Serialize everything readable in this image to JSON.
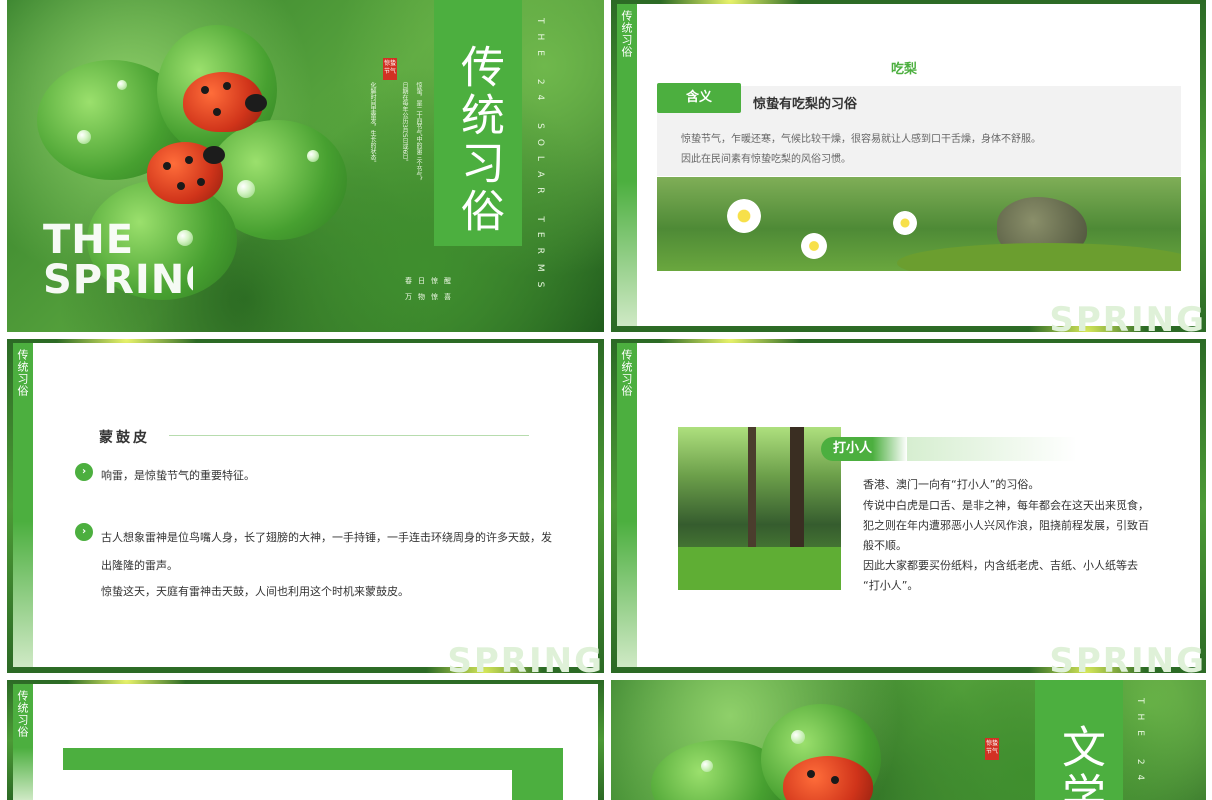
{
  "slides": {
    "title": {
      "section_title": "传统习俗",
      "english_big": [
        "THE",
        "SPRING"
      ],
      "english_vertical": "THE 24 SOLAR TERMS",
      "seal": "惊蛰节气",
      "tagline": [
        "春日惊醒",
        "万物惊喜"
      ],
      "desc_lines": [
        "惊蛰，是二十四节气中的第三个节气，",
        "日期在每年公历3月5日或6日。",
        "化解时间里雷发，生长的状态。"
      ]
    },
    "eat_pear": {
      "side_label": "传统习俗",
      "title": "吃梨",
      "pill": "含义",
      "heading": "惊蛰有吃梨的习俗",
      "lines": [
        "惊蛰节气，乍暖还寒，气候比较干燥，很容易就让人感到口干舌燥，身体不舒服。",
        "因此在民间素有惊蛰吃梨的风俗习惯。"
      ],
      "watermark": "SPRING"
    },
    "drum": {
      "side_label": "传统习俗",
      "heading": "蒙鼓皮",
      "points": [
        "响雷，是惊蛰节气的重要特征。",
        "古人想象雷神是位鸟嘴人身，长了翅膀的大神，一手持锤，一手连击环绕周身的许多天鼓，发"
      ],
      "continuation": "出隆隆的雷声。",
      "extra": "惊蛰这天，天庭有雷神击天鼓，人间也利用这个时机来蒙鼓皮。",
      "watermark": "SPRING"
    },
    "villain": {
      "side_label": "传统习俗",
      "tag": "打小人",
      "lines": [
        "香港、澳门一向有“打小人”的习俗。",
        "传说中白虎是口舌、是非之神，每年都会在这天出来觅食，",
        "犯之则在年内遭邪恶小人兴风作浪，阻挠前程发展，引致百",
        "般不顺。",
        "因此大家都要买份纸料，内含纸老虎、吉纸、小人纸等去",
        "“打小人”。"
      ],
      "watermark": "SPRING"
    },
    "partial": {
      "side_label": "传统习俗"
    },
    "literature": {
      "section_title": "文学",
      "seal": "惊蛰节气",
      "english_vertical": "THE 24"
    }
  },
  "colors": {
    "accent": "#4caf3f",
    "seal_red": "#d23124"
  }
}
